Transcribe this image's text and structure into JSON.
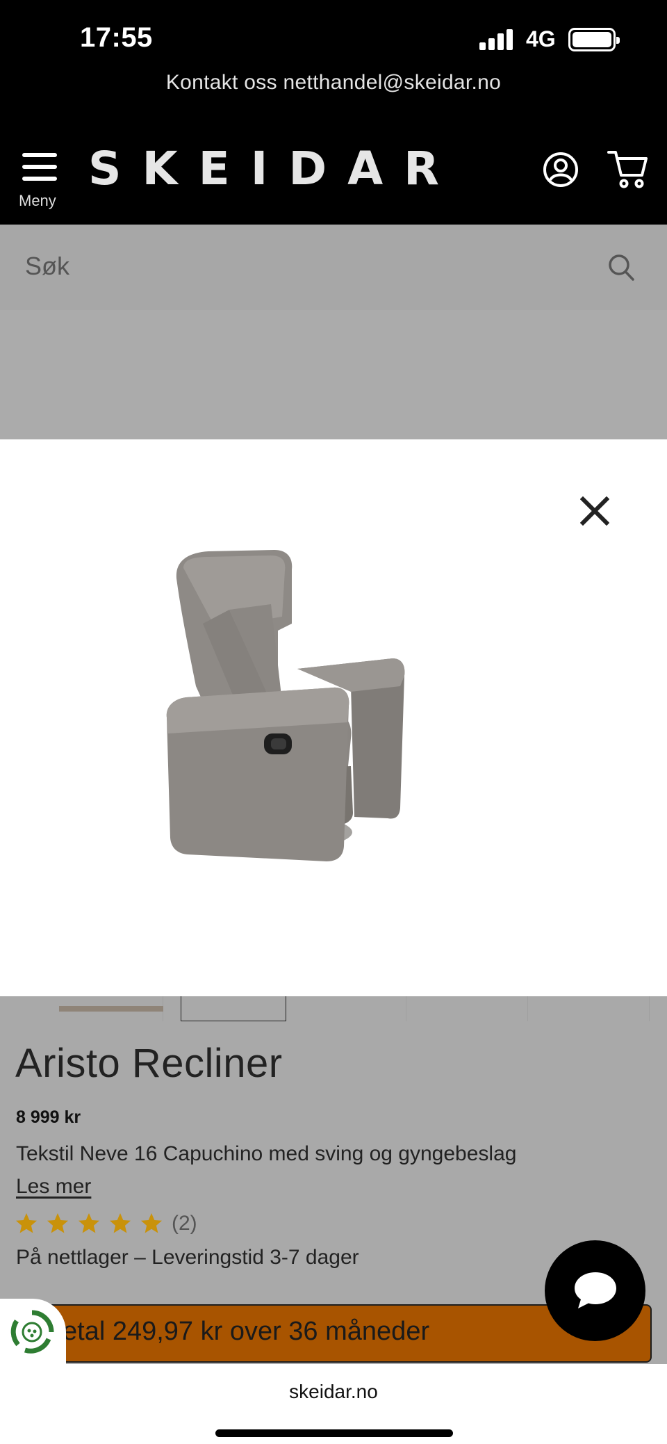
{
  "status_bar": {
    "time": "17:55",
    "network": "4G"
  },
  "header": {
    "contact_text": "Kontakt oss netthandel@skeidar.no",
    "menu_label": "Meny",
    "logo_text": "SKEIDAR"
  },
  "search": {
    "placeholder": "Søk"
  },
  "product": {
    "title": "Aristo Recliner",
    "price": "8 999 kr",
    "description": "Tekstil Neve 16 Capuchino med sving og gyngebeslag",
    "read_more": "Les mer",
    "rating": 5,
    "review_count": "(2)",
    "stock": "På nettlager – Leveringstid 3-7 dager",
    "finance_text": "etal 249,97 kr over 36 måneder"
  },
  "browser": {
    "url": "skeidar.no"
  },
  "colors": {
    "header_bg": "#000000",
    "overlay_gray": "#a9a9a9",
    "finance_button": "#a85400",
    "star": "#c9920a"
  },
  "icons": [
    "menu-icon",
    "account-icon",
    "cart-icon",
    "search-icon",
    "close-icon",
    "star-icon",
    "chat-icon",
    "eco-icon"
  ]
}
